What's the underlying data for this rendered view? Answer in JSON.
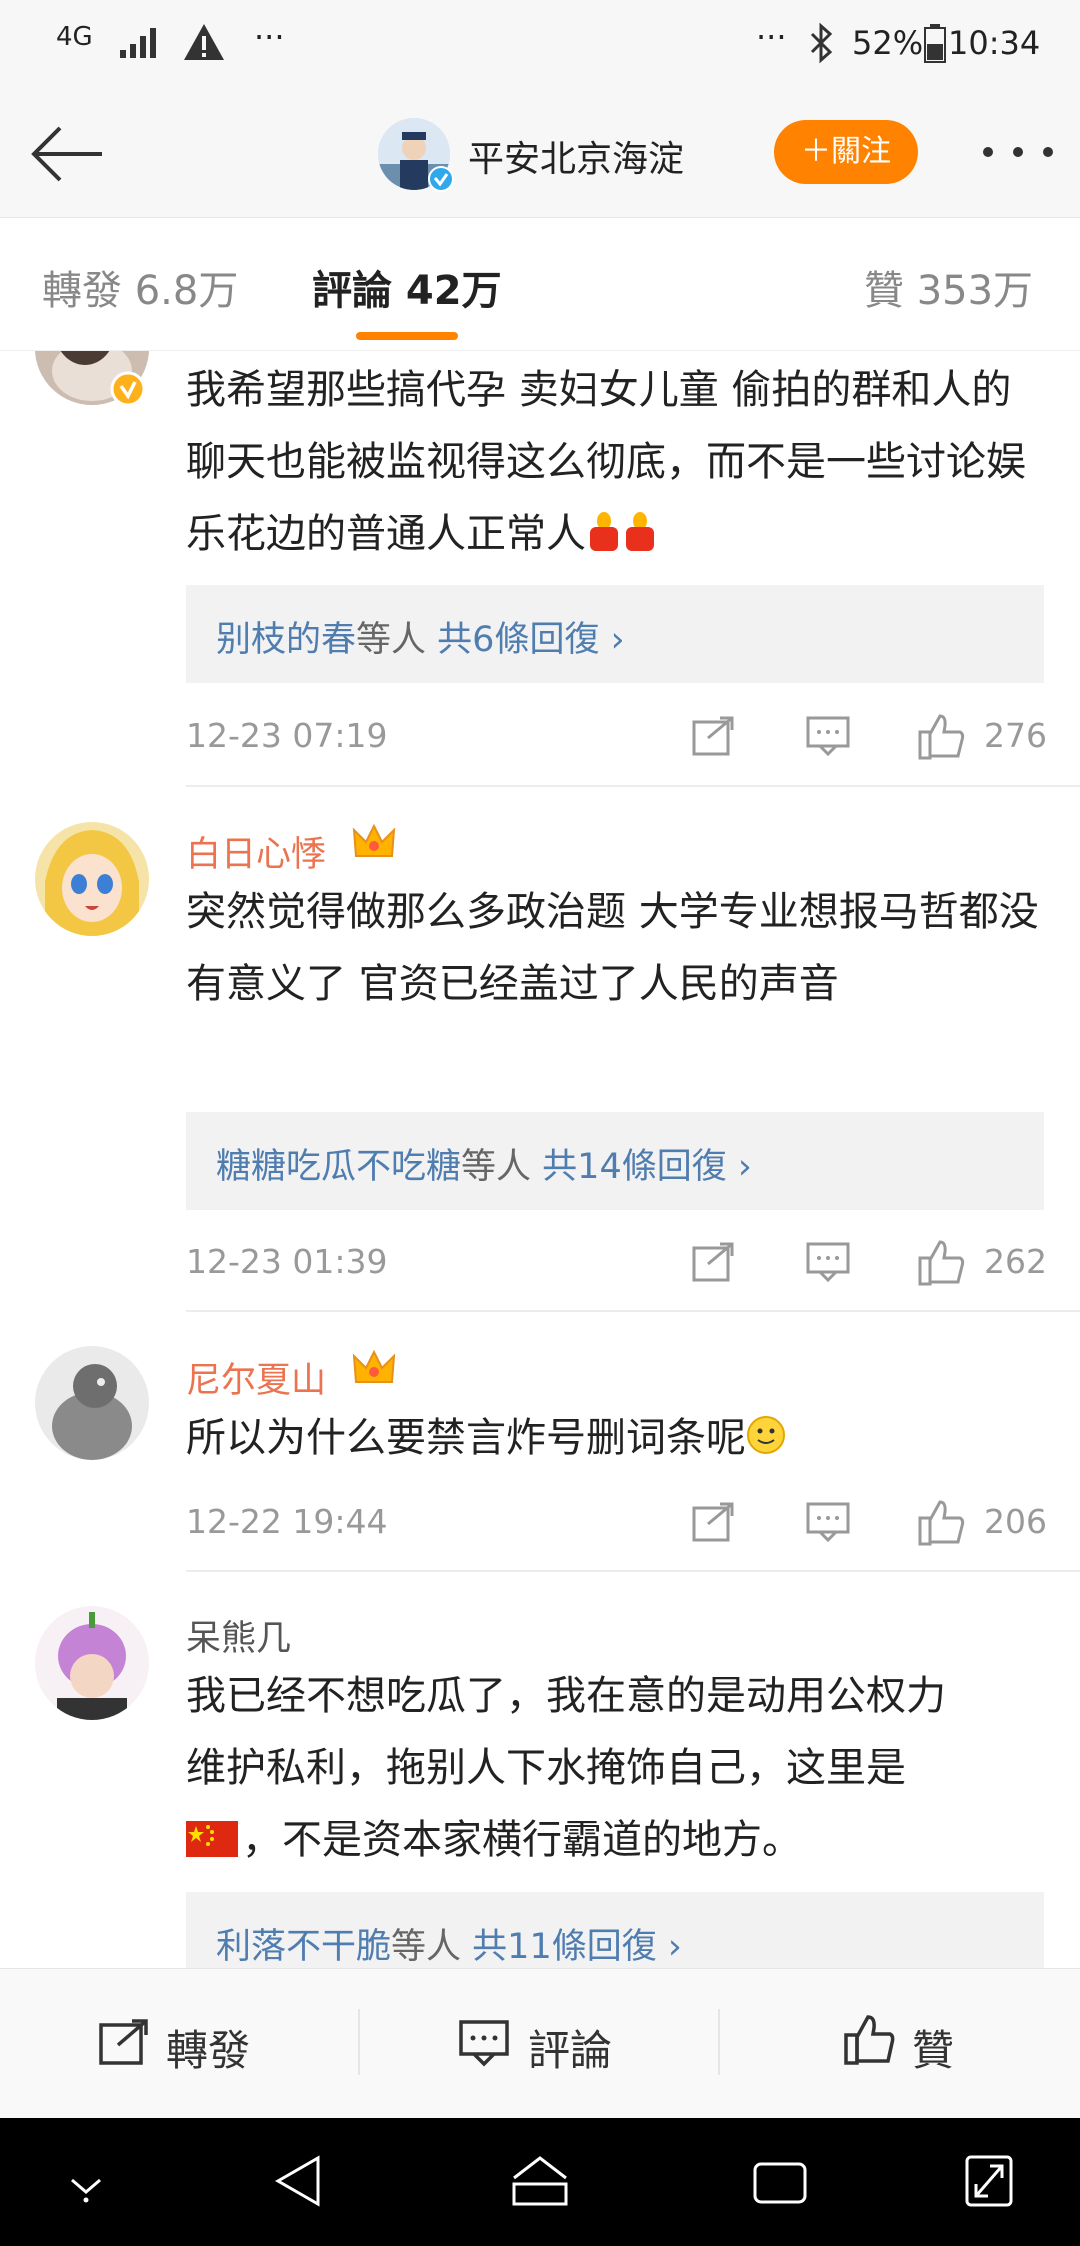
{
  "status_bar": {
    "network": "4G",
    "more_left": "···",
    "more_right": "···",
    "battery": "52%",
    "time": "10:34"
  },
  "header": {
    "title": "平安北京海淀",
    "follow_label": "＋關注"
  },
  "tabs": {
    "repost": "轉發 6.8万",
    "comments": "評論 42万",
    "likes": "贊 353万"
  },
  "comments": [
    {
      "text": "我希望那些搞代孕 卖妇女儿童 偷拍的群和人的聊天也能被监视得这么彻底，而不是一些讨论娱乐花边的普通人正常人",
      "reply_names": "别枝的春",
      "reply_mid": "等人",
      "reply_count": "共6條回復",
      "time": "12-23 07:19",
      "likes": "276"
    },
    {
      "name": "白日心悸",
      "text": "突然觉得做那么多政治题 大学专业想报马哲都没有意义了 官资已经盖过了人民的声音",
      "reply_names": "糖糖吃瓜不吃糖",
      "reply_mid": "等人",
      "reply_count": "共14條回復",
      "time": "12-23 01:39",
      "likes": "262"
    },
    {
      "name": "尼尔夏山",
      "text": "所以为什么要禁言炸号删词条呢",
      "time": "12-22 19:44",
      "likes": "206"
    },
    {
      "name": "呆熊几",
      "text_line1": "我已经不想吃瓜了，我在意的是动用公权力",
      "text_line2": "维护私利，拖别人下水掩饰自己，这里是",
      "text_line3": "，不是资本家横行霸道的地方。",
      "reply_names": "利落不干脆",
      "reply_mid": "等人",
      "reply_count": "共11條回復"
    }
  ],
  "bottom_bar": {
    "repost": "轉發",
    "comment": "評論",
    "like": "贊"
  },
  "colors": {
    "accent": "#ff8200",
    "name": "#eb7350",
    "link": "#507daf"
  }
}
